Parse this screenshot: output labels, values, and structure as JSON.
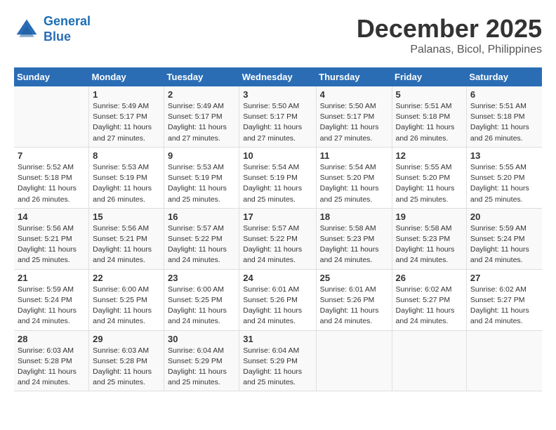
{
  "logo": {
    "line1": "General",
    "line2": "Blue"
  },
  "title": "December 2025",
  "location": "Palanas, Bicol, Philippines",
  "days_of_week": [
    "Sunday",
    "Monday",
    "Tuesday",
    "Wednesday",
    "Thursday",
    "Friday",
    "Saturday"
  ],
  "weeks": [
    [
      {
        "day": "",
        "sunrise": "",
        "sunset": "",
        "daylight": ""
      },
      {
        "day": "1",
        "sunrise": "Sunrise: 5:49 AM",
        "sunset": "Sunset: 5:17 PM",
        "daylight": "Daylight: 11 hours and 27 minutes."
      },
      {
        "day": "2",
        "sunrise": "Sunrise: 5:49 AM",
        "sunset": "Sunset: 5:17 PM",
        "daylight": "Daylight: 11 hours and 27 minutes."
      },
      {
        "day": "3",
        "sunrise": "Sunrise: 5:50 AM",
        "sunset": "Sunset: 5:17 PM",
        "daylight": "Daylight: 11 hours and 27 minutes."
      },
      {
        "day": "4",
        "sunrise": "Sunrise: 5:50 AM",
        "sunset": "Sunset: 5:17 PM",
        "daylight": "Daylight: 11 hours and 27 minutes."
      },
      {
        "day": "5",
        "sunrise": "Sunrise: 5:51 AM",
        "sunset": "Sunset: 5:18 PM",
        "daylight": "Daylight: 11 hours and 26 minutes."
      },
      {
        "day": "6",
        "sunrise": "Sunrise: 5:51 AM",
        "sunset": "Sunset: 5:18 PM",
        "daylight": "Daylight: 11 hours and 26 minutes."
      }
    ],
    [
      {
        "day": "7",
        "sunrise": "Sunrise: 5:52 AM",
        "sunset": "Sunset: 5:18 PM",
        "daylight": "Daylight: 11 hours and 26 minutes."
      },
      {
        "day": "8",
        "sunrise": "Sunrise: 5:53 AM",
        "sunset": "Sunset: 5:19 PM",
        "daylight": "Daylight: 11 hours and 26 minutes."
      },
      {
        "day": "9",
        "sunrise": "Sunrise: 5:53 AM",
        "sunset": "Sunset: 5:19 PM",
        "daylight": "Daylight: 11 hours and 25 minutes."
      },
      {
        "day": "10",
        "sunrise": "Sunrise: 5:54 AM",
        "sunset": "Sunset: 5:19 PM",
        "daylight": "Daylight: 11 hours and 25 minutes."
      },
      {
        "day": "11",
        "sunrise": "Sunrise: 5:54 AM",
        "sunset": "Sunset: 5:20 PM",
        "daylight": "Daylight: 11 hours and 25 minutes."
      },
      {
        "day": "12",
        "sunrise": "Sunrise: 5:55 AM",
        "sunset": "Sunset: 5:20 PM",
        "daylight": "Daylight: 11 hours and 25 minutes."
      },
      {
        "day": "13",
        "sunrise": "Sunrise: 5:55 AM",
        "sunset": "Sunset: 5:20 PM",
        "daylight": "Daylight: 11 hours and 25 minutes."
      }
    ],
    [
      {
        "day": "14",
        "sunrise": "Sunrise: 5:56 AM",
        "sunset": "Sunset: 5:21 PM",
        "daylight": "Daylight: 11 hours and 25 minutes."
      },
      {
        "day": "15",
        "sunrise": "Sunrise: 5:56 AM",
        "sunset": "Sunset: 5:21 PM",
        "daylight": "Daylight: 11 hours and 24 minutes."
      },
      {
        "day": "16",
        "sunrise": "Sunrise: 5:57 AM",
        "sunset": "Sunset: 5:22 PM",
        "daylight": "Daylight: 11 hours and 24 minutes."
      },
      {
        "day": "17",
        "sunrise": "Sunrise: 5:57 AM",
        "sunset": "Sunset: 5:22 PM",
        "daylight": "Daylight: 11 hours and 24 minutes."
      },
      {
        "day": "18",
        "sunrise": "Sunrise: 5:58 AM",
        "sunset": "Sunset: 5:23 PM",
        "daylight": "Daylight: 11 hours and 24 minutes."
      },
      {
        "day": "19",
        "sunrise": "Sunrise: 5:58 AM",
        "sunset": "Sunset: 5:23 PM",
        "daylight": "Daylight: 11 hours and 24 minutes."
      },
      {
        "day": "20",
        "sunrise": "Sunrise: 5:59 AM",
        "sunset": "Sunset: 5:24 PM",
        "daylight": "Daylight: 11 hours and 24 minutes."
      }
    ],
    [
      {
        "day": "21",
        "sunrise": "Sunrise: 5:59 AM",
        "sunset": "Sunset: 5:24 PM",
        "daylight": "Daylight: 11 hours and 24 minutes."
      },
      {
        "day": "22",
        "sunrise": "Sunrise: 6:00 AM",
        "sunset": "Sunset: 5:25 PM",
        "daylight": "Daylight: 11 hours and 24 minutes."
      },
      {
        "day": "23",
        "sunrise": "Sunrise: 6:00 AM",
        "sunset": "Sunset: 5:25 PM",
        "daylight": "Daylight: 11 hours and 24 minutes."
      },
      {
        "day": "24",
        "sunrise": "Sunrise: 6:01 AM",
        "sunset": "Sunset: 5:26 PM",
        "daylight": "Daylight: 11 hours and 24 minutes."
      },
      {
        "day": "25",
        "sunrise": "Sunrise: 6:01 AM",
        "sunset": "Sunset: 5:26 PM",
        "daylight": "Daylight: 11 hours and 24 minutes."
      },
      {
        "day": "26",
        "sunrise": "Sunrise: 6:02 AM",
        "sunset": "Sunset: 5:27 PM",
        "daylight": "Daylight: 11 hours and 24 minutes."
      },
      {
        "day": "27",
        "sunrise": "Sunrise: 6:02 AM",
        "sunset": "Sunset: 5:27 PM",
        "daylight": "Daylight: 11 hours and 24 minutes."
      }
    ],
    [
      {
        "day": "28",
        "sunrise": "Sunrise: 6:03 AM",
        "sunset": "Sunset: 5:28 PM",
        "daylight": "Daylight: 11 hours and 24 minutes."
      },
      {
        "day": "29",
        "sunrise": "Sunrise: 6:03 AM",
        "sunset": "Sunset: 5:28 PM",
        "daylight": "Daylight: 11 hours and 25 minutes."
      },
      {
        "day": "30",
        "sunrise": "Sunrise: 6:04 AM",
        "sunset": "Sunset: 5:29 PM",
        "daylight": "Daylight: 11 hours and 25 minutes."
      },
      {
        "day": "31",
        "sunrise": "Sunrise: 6:04 AM",
        "sunset": "Sunset: 5:29 PM",
        "daylight": "Daylight: 11 hours and 25 minutes."
      },
      {
        "day": "",
        "sunrise": "",
        "sunset": "",
        "daylight": ""
      },
      {
        "day": "",
        "sunrise": "",
        "sunset": "",
        "daylight": ""
      },
      {
        "day": "",
        "sunrise": "",
        "sunset": "",
        "daylight": ""
      }
    ]
  ]
}
